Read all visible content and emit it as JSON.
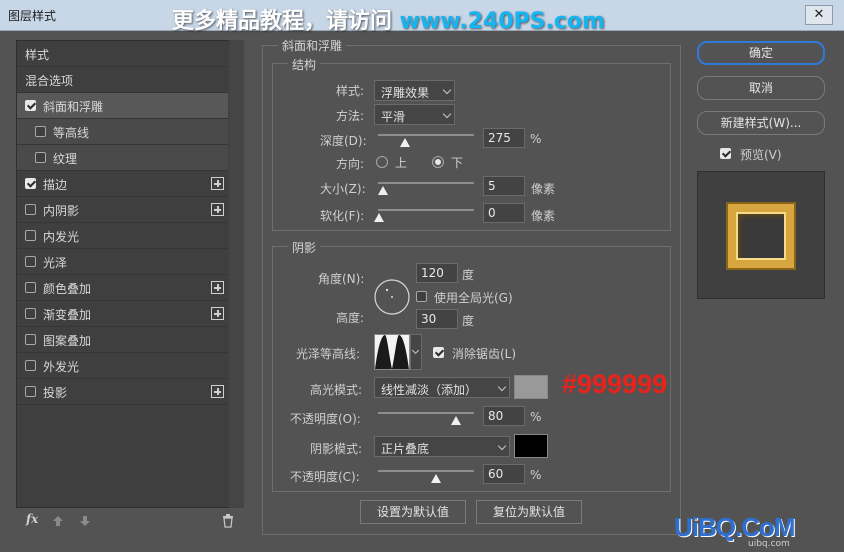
{
  "window": {
    "title": "图层样式",
    "close": "✕"
  },
  "banner": {
    "prefix": "更多精品教程，请访问 ",
    "url": "www.240PS.com"
  },
  "sidebar": {
    "styles_header": "样式",
    "blend_header": "混合选项",
    "items": [
      {
        "label": "斜面和浮雕",
        "checked": true,
        "plus": false,
        "selected": true
      },
      {
        "label": "等高线",
        "checked": false,
        "plus": false,
        "sub": true
      },
      {
        "label": "纹理",
        "checked": false,
        "plus": false,
        "sub": true
      },
      {
        "label": "描边",
        "checked": true,
        "plus": true
      },
      {
        "label": "内阴影",
        "checked": false,
        "plus": true
      },
      {
        "label": "内发光",
        "checked": false,
        "plus": false
      },
      {
        "label": "光泽",
        "checked": false,
        "plus": false
      },
      {
        "label": "颜色叠加",
        "checked": false,
        "plus": true
      },
      {
        "label": "渐变叠加",
        "checked": false,
        "plus": true
      },
      {
        "label": "图案叠加",
        "checked": false,
        "plus": false
      },
      {
        "label": "外发光",
        "checked": false,
        "plus": false
      },
      {
        "label": "投影",
        "checked": false,
        "plus": true
      }
    ],
    "fx": "fx"
  },
  "bevel": {
    "title": "斜面和浮雕",
    "structure": {
      "title": "结构",
      "style_label": "样式:",
      "style_value": "浮雕效果",
      "technique_label": "方法:",
      "technique_value": "平滑",
      "depth_label": "深度(D):",
      "depth_value": "275",
      "depth_unit": "%",
      "direction_label": "方向:",
      "dir_up": "上",
      "dir_down": "下",
      "direction_selected": "下",
      "size_label": "大小(Z):",
      "size_value": "5",
      "size_unit": "像素",
      "soften_label": "软化(F):",
      "soften_value": "0",
      "soften_unit": "像素"
    },
    "shading": {
      "title": "阴影",
      "angle_label": "角度(N):",
      "angle_value": "120",
      "angle_unit": "度",
      "global_light_label": "使用全局光(G)",
      "global_light_checked": false,
      "altitude_label": "高度:",
      "altitude_value": "30",
      "altitude_unit": "度",
      "gloss_label": "光泽等高线:",
      "antialias_label": "消除锯齿(L)",
      "antialias_checked": true,
      "highlight_mode_label": "高光模式:",
      "highlight_mode_value": "线性减淡（添加）",
      "highlight_color": "#999999",
      "highlight_opacity_label": "不透明度(O):",
      "highlight_opacity_value": "80",
      "highlight_opacity_unit": "%",
      "shadow_mode_label": "阴影模式:",
      "shadow_mode_value": "正片叠底",
      "shadow_color": "#000000",
      "shadow_opacity_label": "不透明度(C):",
      "shadow_opacity_value": "60",
      "shadow_opacity_unit": "%"
    },
    "make_default": "设置为默认值",
    "reset_default": "复位为默认值"
  },
  "annotation": {
    "text": "#999999",
    "color": "#e8231c"
  },
  "right": {
    "ok": "确定",
    "cancel": "取消",
    "new_style": "新建样式(W)...",
    "preview_label": "预览(V)",
    "preview_checked": true
  },
  "watermark": {
    "text": "UiBQ.CoM",
    "sub": "uibq.com"
  }
}
